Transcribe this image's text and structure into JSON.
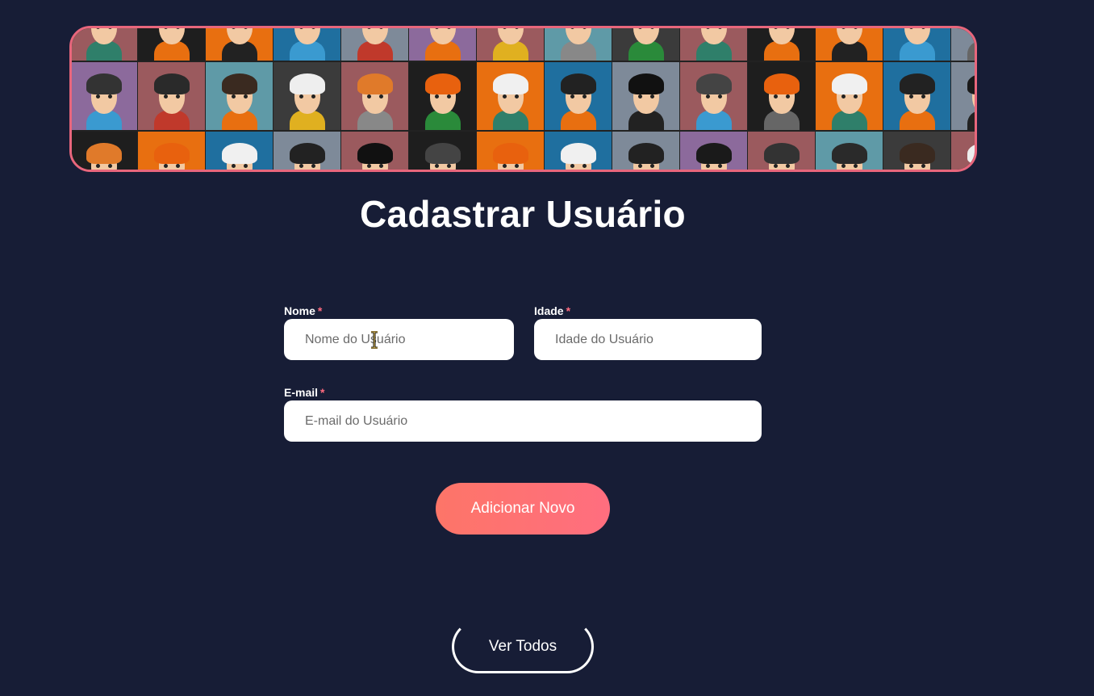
{
  "banner": {
    "image_name": "avatars-banner",
    "border_color": "#e8667c",
    "tile_colors": [
      "#9b5a5e",
      "#1e1e1e",
      "#e86f10",
      "#1f6f9f",
      "#7e8a99",
      "#8c6a9c",
      "#9b5a5e",
      "#5f9aa7",
      "#3b3b3b",
      "#9b5a5e",
      "#1e1e1e",
      "#e86f10",
      "#1f6f9f",
      "#7e8a99"
    ]
  },
  "page": {
    "title": "Cadastrar Usuário"
  },
  "form": {
    "name": {
      "label": "Nome",
      "required_mark": "*",
      "placeholder": "Nome do Usuário",
      "value": ""
    },
    "age": {
      "label": "Idade",
      "required_mark": "*",
      "placeholder": "Idade do Usuário",
      "value": ""
    },
    "email": {
      "label": "E-mail",
      "required_mark": "*",
      "placeholder": "E-mail do Usuário",
      "value": ""
    }
  },
  "actions": {
    "add_label": "Adicionar Novo",
    "view_all_label": "Ver Todos"
  },
  "colors": {
    "background": "#171d36",
    "required": "#ff6b7f",
    "button_gradient_start": "#fd7568",
    "button_gradient_end": "#ff6e7f"
  }
}
